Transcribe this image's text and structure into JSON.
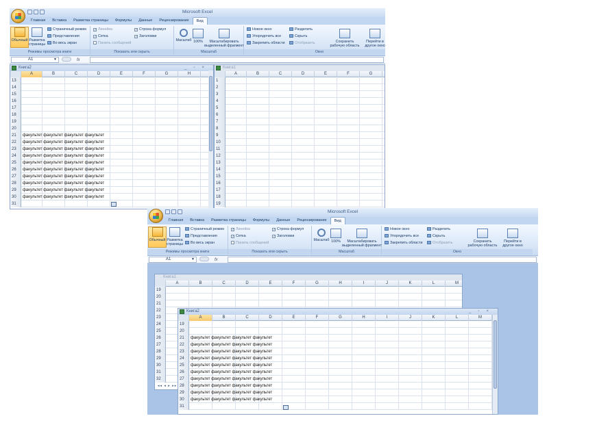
{
  "app_title": "Microsoft Excel",
  "ribbon": {
    "tabs": [
      "Главная",
      "Вставка",
      "Разметка страницы",
      "Формулы",
      "Данные",
      "Рецензирование",
      "Вид"
    ],
    "active_tab": "Вид",
    "views_group": {
      "caption": "Режимы просмотра книги",
      "normal": "Обычный",
      "page_layout_1": "Разметка",
      "page_layout_2": "страницы",
      "page_break": "Страничный режим",
      "custom_views": "Представления",
      "full_screen": "Во весь экран"
    },
    "show_group": {
      "caption": "Показать или скрыть",
      "ruler": "Линейка",
      "gridlines": "Сетка",
      "message_bar": "Панель сообщений",
      "formula_bar": "Строка формул",
      "headings": "Заголовки"
    },
    "zoom_group": {
      "caption": "Масштаб",
      "zoom": "Масштаб",
      "hundred": "100%",
      "zoom_sel_1": "Масштабировать",
      "zoom_sel_2": "выделенный фрагмент"
    },
    "window_group": {
      "caption": "Окно",
      "new_window": "Новое окно",
      "arrange_all": "Упорядочить все",
      "freeze": "Закрепить области",
      "split": "Разделить",
      "hide": "Скрыть",
      "unhide": "Отобразить",
      "save_ws_1": "Сохранить",
      "save_ws_2": "рабочую область",
      "switch_1": "Перейти в",
      "switch_2": "другое окно"
    }
  },
  "formula_bar": {
    "name_box": "A1",
    "fx": "fx"
  },
  "top_windows": {
    "left": {
      "title": "Книга2",
      "columns": [
        "A",
        "B",
        "C",
        "D",
        "E",
        "F",
        "G",
        "H"
      ],
      "rows": [
        {
          "n": "13",
          "text": ""
        },
        {
          "n": "14",
          "text": ""
        },
        {
          "n": "15",
          "text": ""
        },
        {
          "n": "16",
          "text": ""
        },
        {
          "n": "17",
          "text": ""
        },
        {
          "n": "18",
          "text": ""
        },
        {
          "n": "19",
          "text": ""
        },
        {
          "n": "20",
          "text": ""
        },
        {
          "n": "21",
          "text": "факультет факультет факультет факультет"
        },
        {
          "n": "22",
          "text": "факультет факультет факультет факультет"
        },
        {
          "n": "23",
          "text": "факультет факультет факультет факультет"
        },
        {
          "n": "24",
          "text": "факультет факультет факультет факультет"
        },
        {
          "n": "25",
          "text": "факультет факультет факультет факультет"
        },
        {
          "n": "26",
          "text": "факультет факультет факультет факультет"
        },
        {
          "n": "27",
          "text": "факультет факультет факультет факультет"
        },
        {
          "n": "28",
          "text": "факультет факультет факультет факультет"
        },
        {
          "n": "29",
          "text": "факультет факультет факультет факультет"
        },
        {
          "n": "30",
          "text": "факультет факультет факультет факультет"
        },
        {
          "n": "31",
          "text": ""
        }
      ]
    },
    "right": {
      "title": "Книга1",
      "columns": [
        "A",
        "B",
        "C",
        "D",
        "E",
        "F",
        "G"
      ],
      "rows": [
        "1",
        "2",
        "3",
        "4",
        "5",
        "6",
        "7",
        "8",
        "9",
        "10",
        "11",
        "12",
        "13",
        "14",
        "15",
        "16",
        "17",
        "18",
        "19"
      ]
    }
  },
  "bottom_windows": {
    "back": {
      "title": "Книга1",
      "columns": [
        "A",
        "B",
        "C",
        "D",
        "E",
        "F",
        "G",
        "H",
        "I",
        "J",
        "K",
        "L",
        "M"
      ],
      "rows": [
        "19",
        "20",
        "21",
        "22",
        "23",
        "24",
        "25",
        "26",
        "27",
        "28",
        "29",
        "30",
        "31",
        "32"
      ],
      "sheet_nav": "◂◂ ◂ ▸ ▸▸"
    },
    "front": {
      "title": "Книга2",
      "columns": [
        "A",
        "B",
        "C",
        "D",
        "E",
        "F",
        "G",
        "H",
        "I",
        "J",
        "K",
        "L",
        "M"
      ],
      "rows": [
        {
          "n": "19",
          "text": ""
        },
        {
          "n": "20",
          "text": ""
        },
        {
          "n": "21",
          "text": "факультет факультет факультет факультет"
        },
        {
          "n": "22",
          "text": "факультет факультет факультет факультет"
        },
        {
          "n": "23",
          "text": "факультет факультет факультет факультет"
        },
        {
          "n": "24",
          "text": "факультет факультет факультет факультет"
        },
        {
          "n": "25",
          "text": "факультет факультет факультет факультет"
        },
        {
          "n": "26",
          "text": "факультет факультет факультет факультет"
        },
        {
          "n": "27",
          "text": "факультет факультет факультет факультет"
        },
        {
          "n": "28",
          "text": "факультет факультет факультет факультет"
        },
        {
          "n": "29",
          "text": "факультет факультет факультет факультет"
        },
        {
          "n": "30",
          "text": "факультет факультет факультет факультет"
        },
        {
          "n": "31",
          "text": ""
        }
      ]
    }
  }
}
